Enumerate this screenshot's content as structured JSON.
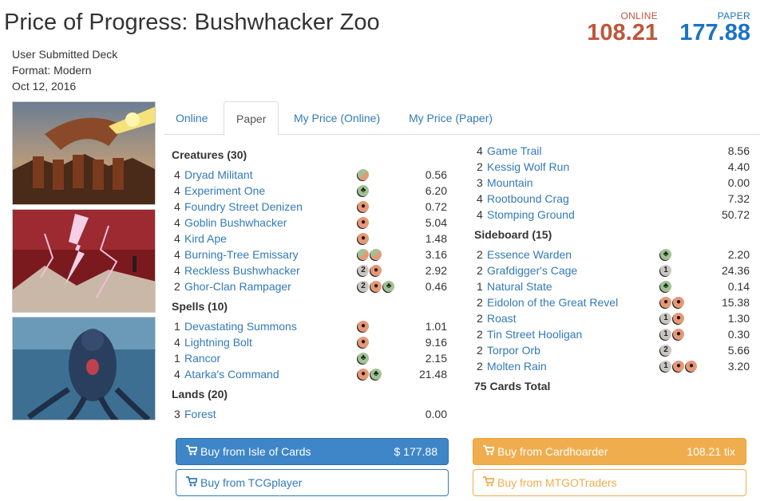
{
  "deck": {
    "title": "Price of Progress: Bushwhacker Zoo",
    "source": "User Submitted Deck",
    "format": "Format: Modern",
    "date": "Oct 12, 2016"
  },
  "prices": {
    "online_label": "ONLINE",
    "online_value": "108.21",
    "paper_label": "PAPER",
    "paper_value": "177.88"
  },
  "tabs": [
    "Online",
    "Paper",
    "My Price (Online)",
    "My Price (Paper)"
  ],
  "active_tab": "Paper",
  "sections_left": [
    {
      "title": "Creatures (30)",
      "cards": [
        {
          "qty": "4",
          "name": "Dryad Militant",
          "mana": [
            "rg"
          ],
          "price": "0.56"
        },
        {
          "qty": "4",
          "name": "Experiment One",
          "mana": [
            "g"
          ],
          "price": "6.20"
        },
        {
          "qty": "4",
          "name": "Foundry Street Denizen",
          "mana": [
            "r"
          ],
          "price": "0.72"
        },
        {
          "qty": "4",
          "name": "Goblin Bushwhacker",
          "mana": [
            "r"
          ],
          "price": "5.04"
        },
        {
          "qty": "4",
          "name": "Kird Ape",
          "mana": [
            "r"
          ],
          "price": "1.48"
        },
        {
          "qty": "4",
          "name": "Burning-Tree Emissary",
          "mana": [
            "rg",
            "rg"
          ],
          "price": "3.16"
        },
        {
          "qty": "4",
          "name": "Reckless Bushwhacker",
          "mana": [
            "2",
            "r"
          ],
          "price": "2.92"
        },
        {
          "qty": "2",
          "name": "Ghor-Clan Rampager",
          "mana": [
            "2",
            "r",
            "g"
          ],
          "price": "0.46"
        }
      ]
    },
    {
      "title": "Spells (10)",
      "cards": [
        {
          "qty": "1",
          "name": "Devastating Summons",
          "mana": [
            "r"
          ],
          "price": "1.01"
        },
        {
          "qty": "4",
          "name": "Lightning Bolt",
          "mana": [
            "r"
          ],
          "price": "9.16"
        },
        {
          "qty": "1",
          "name": "Rancor",
          "mana": [
            "g"
          ],
          "price": "2.15"
        },
        {
          "qty": "4",
          "name": "Atarka's Command",
          "mana": [
            "r",
            "g"
          ],
          "price": "21.48"
        }
      ]
    },
    {
      "title": "Lands (20)",
      "cards": [
        {
          "qty": "3",
          "name": "Forest",
          "mana": [],
          "price": "0.00"
        }
      ]
    }
  ],
  "lands_continued": [
    {
      "qty": "4",
      "name": "Game Trail",
      "mana": [],
      "price": "8.56"
    },
    {
      "qty": "2",
      "name": "Kessig Wolf Run",
      "mana": [],
      "price": "4.40"
    },
    {
      "qty": "3",
      "name": "Mountain",
      "mana": [],
      "price": "0.00"
    },
    {
      "qty": "4",
      "name": "Rootbound Crag",
      "mana": [],
      "price": "7.32"
    },
    {
      "qty": "4",
      "name": "Stomping Ground",
      "mana": [],
      "price": "50.72"
    }
  ],
  "sideboard": {
    "title": "Sideboard (15)",
    "cards": [
      {
        "qty": "2",
        "name": "Essence Warden",
        "mana": [
          "g"
        ],
        "price": "2.20"
      },
      {
        "qty": "2",
        "name": "Grafdigger's Cage",
        "mana": [
          "1"
        ],
        "price": "24.36"
      },
      {
        "qty": "1",
        "name": "Natural State",
        "mana": [
          "g"
        ],
        "price": "0.14"
      },
      {
        "qty": "2",
        "name": "Eidolon of the Great Revel",
        "mana": [
          "r",
          "r"
        ],
        "price": "15.38"
      },
      {
        "qty": "2",
        "name": "Roast",
        "mana": [
          "1",
          "r"
        ],
        "price": "1.30"
      },
      {
        "qty": "2",
        "name": "Tin Street Hooligan",
        "mana": [
          "1",
          "r"
        ],
        "price": "0.30"
      },
      {
        "qty": "2",
        "name": "Torpor Orb",
        "mana": [
          "2"
        ],
        "price": "5.66"
      },
      {
        "qty": "2",
        "name": "Molten Rain",
        "mana": [
          "1",
          "r",
          "r"
        ],
        "price": "3.20"
      }
    ]
  },
  "total": "75 Cards Total",
  "buttons": {
    "isle_label": "Buy from Isle of Cards",
    "isle_amount": "$ 177.88",
    "tcg_label": "Buy from TCGplayer",
    "cardhoarder_label": "Buy from Cardhoarder",
    "cardhoarder_amount": "108.21 tix",
    "mtgo_label": "Buy from MTGOTraders"
  },
  "colors": {
    "online": "#c0563b",
    "paper": "#1a73c8",
    "link": "#337ab7",
    "primary_btn": "#3f86c8",
    "warning_btn": "#f0ad4e"
  },
  "icons": [
    "cart-icon",
    "red-mana-icon",
    "green-mana-icon",
    "hybrid-mana-icon",
    "generic-mana-icon"
  ]
}
